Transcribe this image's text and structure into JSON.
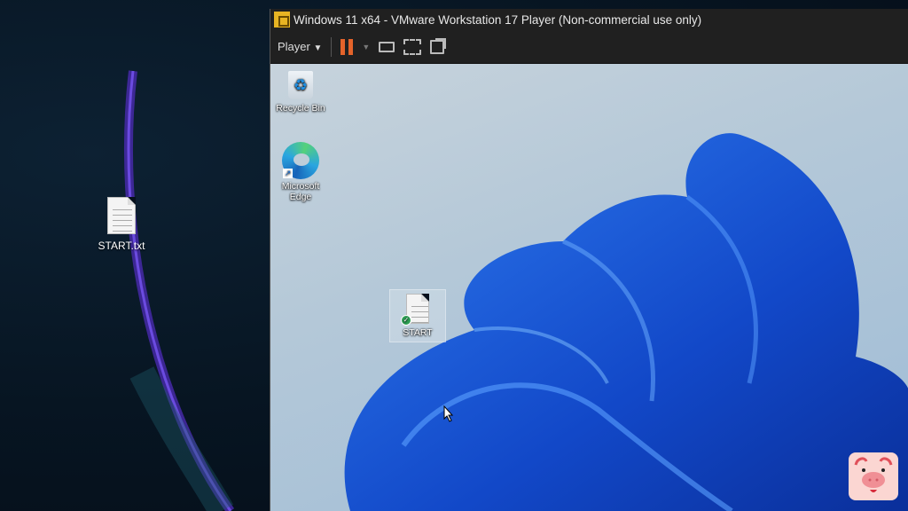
{
  "host_desktop": {
    "icons": [
      {
        "label": "START.txt",
        "icon": "text-file-icon"
      }
    ]
  },
  "vm_window": {
    "title": "Windows 11 x64 - VMware Workstation 17 Player (Non-commercial use only)",
    "toolbar": {
      "player_menu": "Player",
      "buttons": [
        "pause-icon",
        "send-ctrl-alt-del-icon",
        "fullscreen-icon",
        "unity-icon"
      ]
    },
    "guest_desktop": {
      "icons": [
        {
          "label": "Recycle Bin"
        },
        {
          "label": "Microsoft Edge"
        },
        {
          "label": "START"
        }
      ]
    }
  },
  "colors": {
    "pause": "#e4632a",
    "titlebar": "#202020",
    "bloom": "#1a5fe0"
  }
}
